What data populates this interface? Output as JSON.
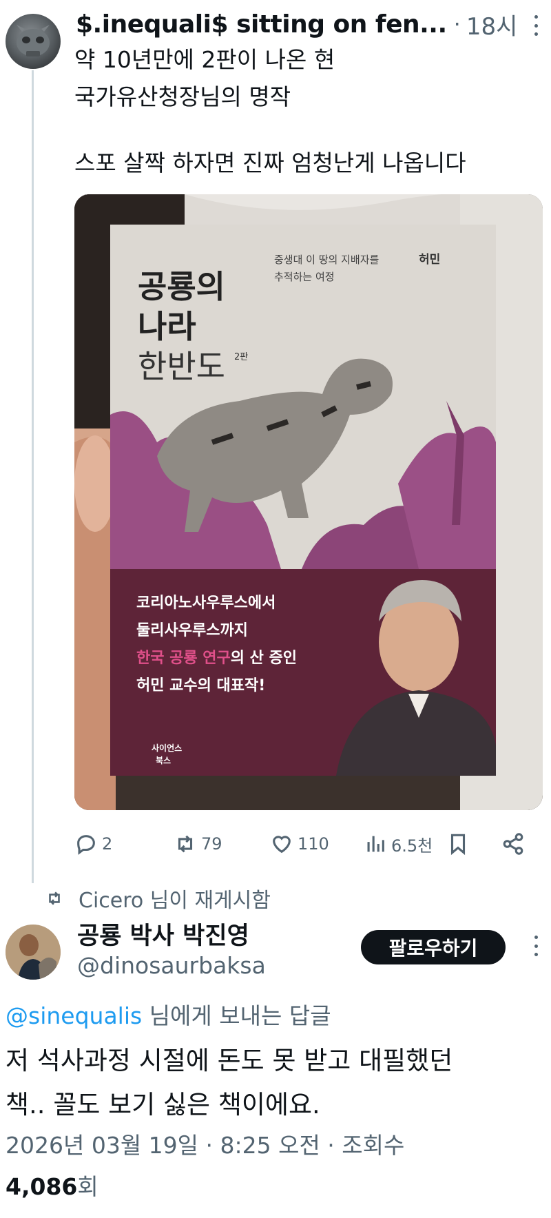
{
  "tweet": {
    "author_name": "$.inequali$ sitting on fen...",
    "separator": "·",
    "time": "18시",
    "text_lines": [
      "약 10년만에 2판이 나온 현",
      "국가유산청장님의 명작"
    ],
    "text_lines_2": [
      "스포 살짝 하자면 진짜 엄청난게 나옵니다"
    ],
    "image": {
      "subtitle_line1": "중생대 이 땅의 지배자를",
      "subtitle_line2": "추적하는 여정",
      "author": "허민",
      "title_line1": "공룡의",
      "title_line2": "나라",
      "title_line3": "한반도",
      "edition": "2판",
      "band_line1": "코리아노사우루스에서",
      "band_line2": "둘리사우루스까지",
      "band_highlight": "한국 공룡 연구",
      "band_line3_rest": "의 산 증인",
      "band_line4": "허민 교수의 대표작!",
      "publisher_line1": "사이언스",
      "publisher_line2": "북스"
    },
    "actions": {
      "reply_count": "2",
      "repost_count": "79",
      "like_count": "110",
      "view_count": "6.5천"
    }
  },
  "reposted_by": "Cicero 님이 재게시함",
  "reply": {
    "author_name": "공룡 박사 박진영",
    "handle": "@dinosaurbaksa",
    "follow_label": "팔로우하기",
    "reply_to_mention": "@sinequalis",
    "reply_to_suffix": " 님에게 보내는 답글",
    "text_lines": [
      "저 석사과정 시절에 돈도 못 받고 대필했던",
      "책.. 꼴도 보기 싫은 책이에요."
    ],
    "meta": "2026년 03월 19일 · 8:25 오전 · 조회수",
    "views_count": "4,086",
    "views_suffix": "회"
  },
  "colors": {
    "text_primary": "#0f1419",
    "text_secondary": "#536471",
    "link": "#1d9bf0",
    "book_band": "#5e2438",
    "book_highlight": "#e0508a"
  }
}
